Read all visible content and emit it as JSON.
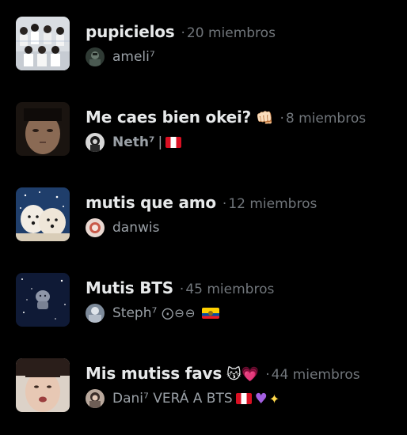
{
  "communities": [
    {
      "title": "pupicielos",
      "title_emoji": "",
      "members": "20 miembros",
      "separator": "·",
      "owner": "ameli⁷",
      "owner_extra": ""
    },
    {
      "title": "Me caes bien okei?",
      "title_emoji": "👊🏻",
      "members": "8 miembros",
      "separator": "·",
      "owner": "Neth⁷",
      "owner_extra": "|"
    },
    {
      "title": "mutis que amo",
      "title_emoji": "",
      "members": "12 miembros",
      "separator": "·",
      "owner": "danwis",
      "owner_extra": ""
    },
    {
      "title": "Mutis BTS",
      "title_emoji": "",
      "members": "45 miembros",
      "separator": "·",
      "owner": "Steph⁷",
      "owner_extra": "⨀⊖⊖"
    },
    {
      "title": "Mis mutiss favs",
      "title_emoji": "😽💗",
      "members": "44 miembros",
      "separator": "·",
      "owner": "Dani⁷ VERÁ A BTS",
      "owner_extra": ""
    }
  ],
  "colors": {
    "background": "#000000",
    "title": "#e7e9ea",
    "muted": "#71767b",
    "owner_text": "#9aa0a6"
  }
}
